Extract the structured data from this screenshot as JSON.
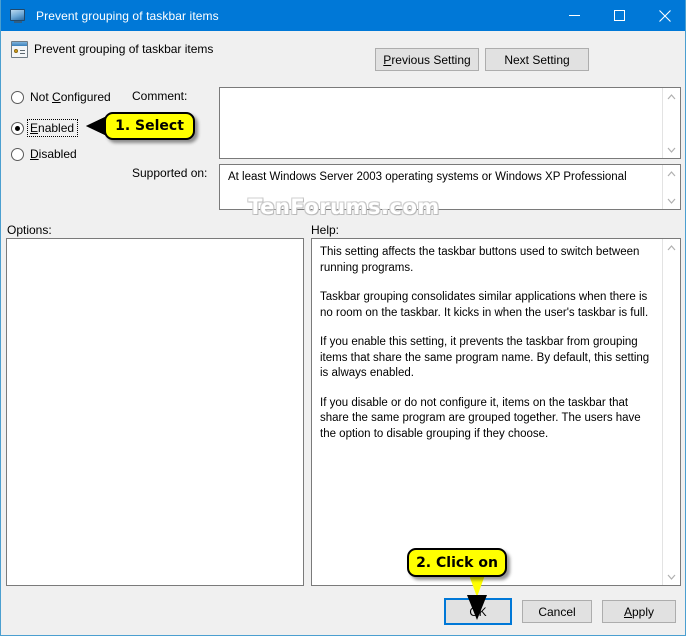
{
  "window": {
    "title": "Prevent grouping of taskbar items",
    "title_icon": "monitor-icon",
    "minimize_label": "–",
    "maximize_label": "□",
    "close_label": "×"
  },
  "header": {
    "icon": "policy-setting-icon",
    "title": "Prevent grouping of taskbar items"
  },
  "nav": {
    "previous_setting": "Previous Setting",
    "next_setting": "Next Setting"
  },
  "state_options": [
    {
      "id": "not-configured",
      "label_pre": "Not ",
      "label_accel": "C",
      "label_post": "onfigured",
      "selected": false,
      "focused": false
    },
    {
      "id": "enabled",
      "label_pre": "",
      "label_accel": "E",
      "label_post": "nabled",
      "selected": true,
      "focused": true
    },
    {
      "id": "disabled",
      "label_pre": "",
      "label_accel": "D",
      "label_post": "isabled",
      "selected": false,
      "focused": false
    }
  ],
  "fields": {
    "comment_label": "Comment:",
    "comment_value": "",
    "supported_label": "Supported on:",
    "supported_value": "At least Windows Server 2003 operating systems or Windows XP Professional",
    "options_label": "Options:",
    "options_value": "",
    "help_label": "Help:"
  },
  "help": {
    "paragraphs": [
      "This setting affects the taskbar buttons used to switch between running programs.",
      "Taskbar grouping consolidates similar applications when there is no room on the taskbar. It kicks in when the user's taskbar is full.",
      "If you enable this setting, it prevents the taskbar from grouping items that share the same program name. By default, this setting is always enabled.",
      "If you disable or do not configure it, items on the taskbar that share the same program are grouped together. The users have the option to disable grouping if they choose."
    ]
  },
  "watermark": "TenForums.com",
  "buttons": {
    "ok": "OK",
    "cancel": "Cancel",
    "apply_pre": "",
    "apply_accel": "A",
    "apply_post": "pply"
  },
  "callouts": {
    "step1": "1. Select",
    "step2": "2. Click on"
  },
  "colors": {
    "titlebar": "#0078d7",
    "focus_border": "#0078d7",
    "window_border": "#4b9fd0",
    "dialog_bg": "#f0f0f0",
    "callout_bg": "#ffff00"
  }
}
